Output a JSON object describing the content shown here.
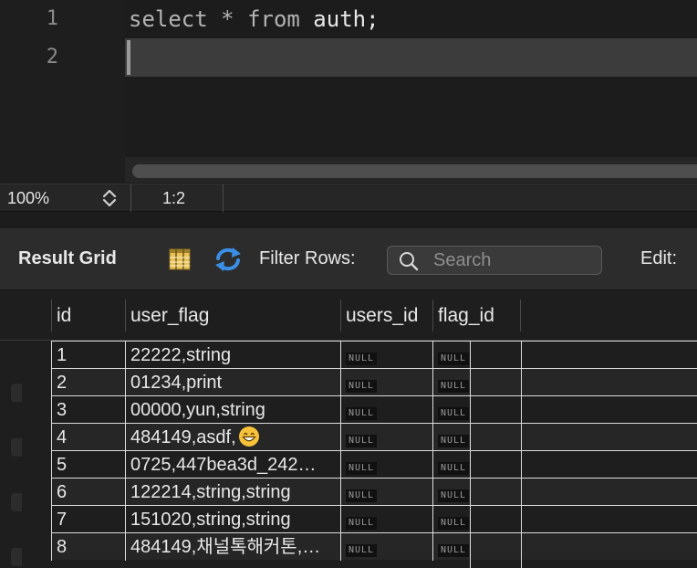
{
  "editor": {
    "lines": [
      {
        "number": "1",
        "tokens": [
          {
            "text": "select",
            "kind": "kw"
          },
          {
            "text": " * ",
            "kind": "kw"
          },
          {
            "text": "from",
            "kind": "kw"
          },
          {
            "text": " auth;",
            "kind": "id"
          }
        ]
      },
      {
        "number": "2",
        "tokens": []
      }
    ]
  },
  "statusbar": {
    "zoom": "100%",
    "cursor_position": "1:2"
  },
  "toolbar": {
    "title": "Result Grid",
    "grid_icon": "result-grid-icon",
    "refresh_icon": "refresh-icon",
    "filter_label": "Filter Rows:",
    "search_placeholder": "Search",
    "search_value": "",
    "edit_label": "Edit:"
  },
  "grid": {
    "columns": [
      "id",
      "user_flag",
      "users_id",
      "flag_id"
    ],
    "rows": [
      {
        "id": "1",
        "user_flag": "22222,string",
        "users_id": "NULL",
        "flag_id": "NULL"
      },
      {
        "id": "2",
        "user_flag": "01234,print",
        "users_id": "NULL",
        "flag_id": "NULL"
      },
      {
        "id": "3",
        "user_flag": "00000,yun,string",
        "users_id": "NULL",
        "flag_id": "NULL"
      },
      {
        "id": "4",
        "user_flag": "484149,asdf,",
        "user_flag_emoji": "grinning-face-icon",
        "users_id": "NULL",
        "flag_id": "NULL"
      },
      {
        "id": "5",
        "user_flag": "0725,447bea3d_242…",
        "users_id": "NULL",
        "flag_id": "NULL"
      },
      {
        "id": "6",
        "user_flag": "122214,string,string",
        "users_id": "NULL",
        "flag_id": "NULL"
      },
      {
        "id": "7",
        "user_flag": "151020,string,string",
        "users_id": "NULL",
        "flag_id": "NULL"
      },
      {
        "id": "8",
        "user_flag": "484149,채널톡해커톤,…",
        "users_id": "NULL",
        "flag_id": "NULL"
      }
    ]
  },
  "colors": {
    "background": "#1e1e1e",
    "toolbar": "#2c2c2c",
    "refresh_accent": "#3a8ee6",
    "grid_icon_accent": "#e8c15a"
  }
}
